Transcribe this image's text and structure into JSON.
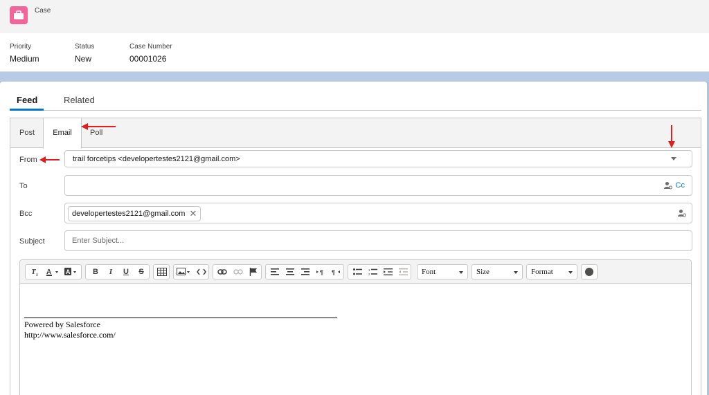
{
  "header": {
    "object_label": "Case",
    "icon": "briefcase-icon",
    "icon_color": "#f2659b"
  },
  "highlights": [
    {
      "label": "Priority",
      "value": "Medium"
    },
    {
      "label": "Status",
      "value": "New"
    },
    {
      "label": "Case Number",
      "value": "00001026"
    }
  ],
  "feed_tabs": [
    {
      "label": "Feed",
      "active": true
    },
    {
      "label": "Related",
      "active": false
    }
  ],
  "publisher_tabs": [
    {
      "label": "Post",
      "active": false
    },
    {
      "label": "Email",
      "active": true
    },
    {
      "label": "Poll",
      "active": false
    }
  ],
  "email": {
    "from_label": "From",
    "from_value": "trail forcetips <developertestes2121@gmail.com>",
    "to_label": "To",
    "cc_label": "Cc",
    "bcc_label": "Bcc",
    "bcc_recipients": [
      "developertestes2121@gmail.com"
    ],
    "subject_label": "Subject",
    "subject_value": "",
    "subject_placeholder": "Enter Subject..."
  },
  "toolbar": {
    "font_label": "Font",
    "size_label": "Size",
    "format_label": "Format",
    "bold_glyph": "B",
    "italic_glyph": "I",
    "underline_glyph": "U",
    "strike_glyph": "S"
  },
  "signature": {
    "line1": "Powered by Salesforce",
    "line2": "http://www.salesforce.com/"
  },
  "colors": {
    "accent": "#0176d3",
    "annotation_arrow": "#e01e1e"
  }
}
